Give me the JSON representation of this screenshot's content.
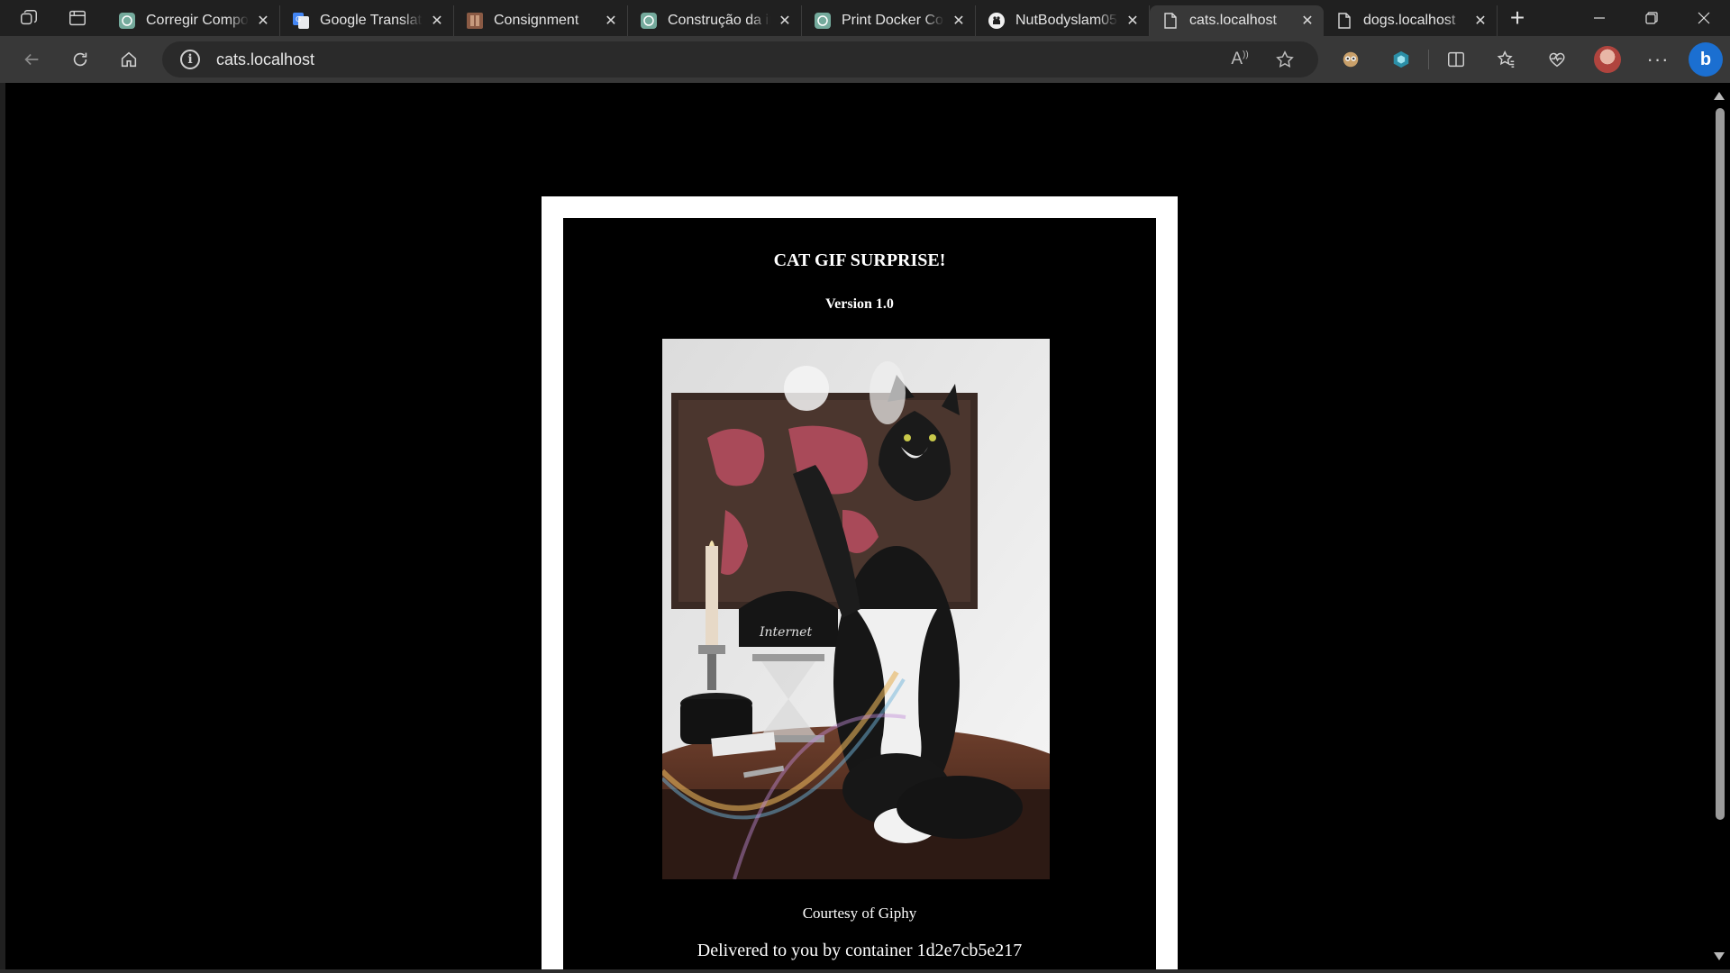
{
  "browser": {
    "tabs": [
      {
        "title": "Corregir Compo",
        "icon": "chatgpt-icon",
        "active": false
      },
      {
        "title": "Google Translate",
        "icon": "google-translate-icon",
        "active": false
      },
      {
        "title": "Consignment",
        "icon": "book-icon",
        "active": false
      },
      {
        "title": "Construção da ir",
        "icon": "chatgpt-icon",
        "active": false
      },
      {
        "title": "Print Docker Cor",
        "icon": "chatgpt-icon",
        "active": false
      },
      {
        "title": "NutBodyslam05",
        "icon": "github-icon",
        "active": false
      },
      {
        "title": "cats.localhost",
        "icon": "page-icon",
        "active": true
      },
      {
        "title": "dogs.localhost",
        "icon": "page-icon",
        "active": false
      }
    ],
    "address": "cats.localhost",
    "colors": {
      "frame": "#202020",
      "toolbar": "#383838",
      "accent": "#1b6fd1"
    }
  },
  "page": {
    "title": "CAT GIF SURPRISE!",
    "version": "Version 1.0",
    "courtesy": "Courtesy of Giphy",
    "delivered": "Delivered to you by container 1d2e7cb5e217",
    "colors": {
      "background": "#000000",
      "card_border": "#ffffff",
      "text": "#ffffff"
    }
  }
}
